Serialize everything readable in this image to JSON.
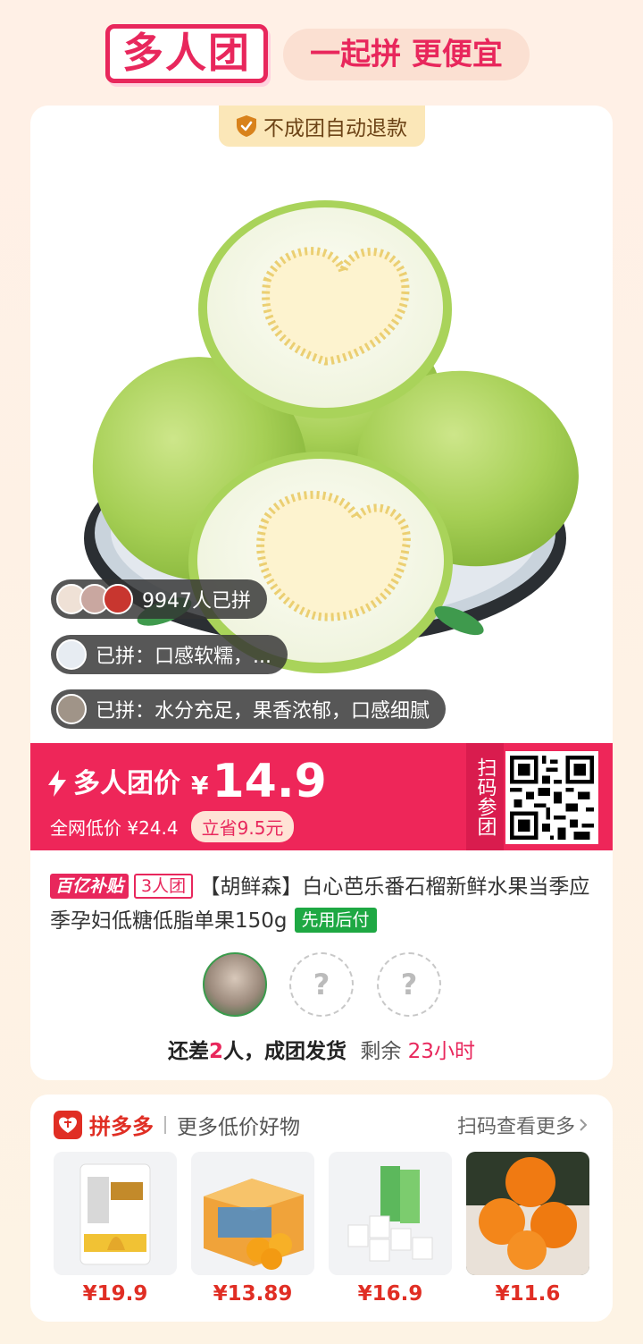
{
  "header": {
    "brand": "多人团",
    "slogan": "一起拼 更便宜"
  },
  "card": {
    "refund_badge": "不成团自动退款",
    "bubbles": {
      "joined_count": "9947人已拼",
      "review_1": "已拼：口感软糯，...",
      "review_2": "已拼：水分充足，果香浓郁，口感细腻"
    },
    "price": {
      "group_label": "多人团价",
      "currency": "¥",
      "value": "14.9",
      "lowest_label": "全网低价 ¥24.4",
      "save": "立省9.5元",
      "scan_join": "扫码参团"
    },
    "title": {
      "subsidy_tag": "百亿补贴",
      "group_tag": "3人团",
      "text": "【胡鲜森】白心芭乐番石榴新鲜水果当季应季孕妇低糖低脂单果150g",
      "paylater_tag": "先用后付"
    },
    "members": {
      "empty_mark": "?"
    },
    "status": {
      "prefix": "还差",
      "count": "2",
      "suffix": "人，成团发货",
      "remaining_label": "剩余",
      "remaining_time": "23小时"
    }
  },
  "more": {
    "logo_text": "拼多多",
    "subtitle": "更多低价好物",
    "link": "扫码查看更多",
    "goods": [
      {
        "price": "¥19.9",
        "image": "flour-bag"
      },
      {
        "price": "¥13.89",
        "image": "orange-box"
      },
      {
        "price": "¥16.9",
        "image": "tissue-rolls"
      },
      {
        "price": "¥11.6",
        "image": "oranges-in-hands"
      }
    ]
  },
  "colors": {
    "brand_red": "#e8275c",
    "pdd_red": "#e02e24",
    "price_band": "#ee2659",
    "green_tag": "#1ea843"
  }
}
